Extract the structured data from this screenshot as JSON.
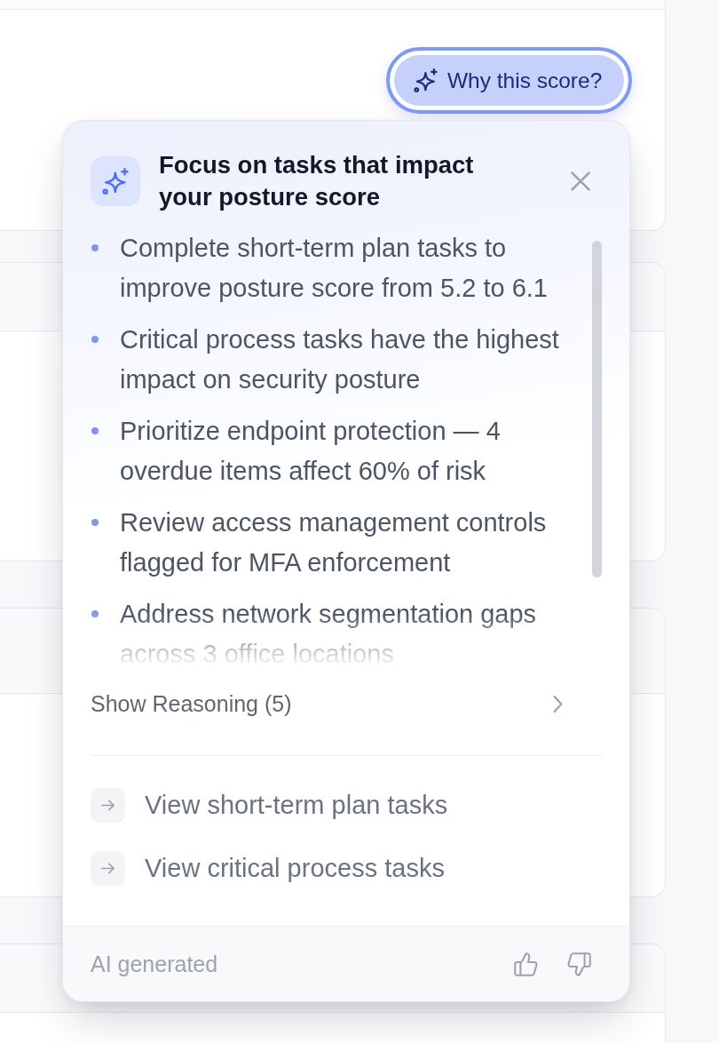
{
  "score_button": {
    "label": "Why this score?"
  },
  "popover": {
    "title": "Focus on tasks that impact your posture score",
    "insights": [
      "Complete short-term plan tasks to improve posture score from 5.2 to 6.1",
      "Critical process tasks have the highest impact on security posture",
      "Prioritize endpoint protection — 4 overdue items affect 60% of risk",
      "Review access management controls flagged for MFA enforcement",
      "Address network segmentation gaps across 3 office locations"
    ],
    "reasoning": {
      "label": "Show Reasoning (5)",
      "expanded": false
    },
    "links": [
      "View short-term plan tasks",
      "View critical process tasks"
    ],
    "footer": {
      "note": "AI generated"
    }
  }
}
